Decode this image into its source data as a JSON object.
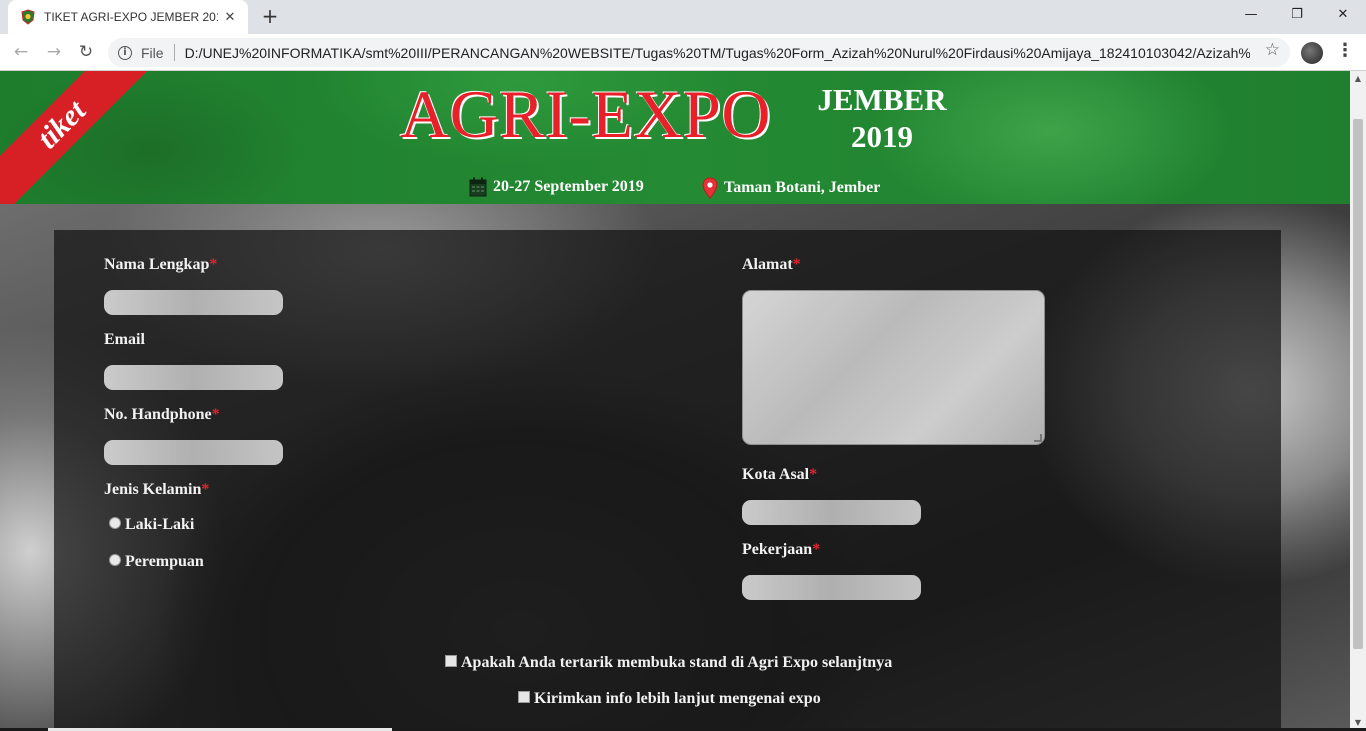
{
  "browser": {
    "tab_title": "TIKET AGRI-EXPO JEMBER 2019",
    "tab_close": "✕",
    "new_tab": "+",
    "window_controls": {
      "minimize": "—",
      "restore": "❐",
      "close": "✕"
    },
    "nav": {
      "back": "←",
      "forward": "→",
      "reload": "↻"
    },
    "file_label": "File",
    "url": "D:/UNEJ%20INFORMATIKA/smt%20III/PERANCANGAN%20WEBSITE/Tugas%20TM/Tugas%20Form_Azizah%20Nurul%20Firdausi%20Amijaya_182410103042/Azizah%20for...",
    "star": "☆",
    "menu": "⋮"
  },
  "header": {
    "ribbon": "tiket",
    "brand": "AGRI-EXPO",
    "brand_city": "JEMBER",
    "brand_year": "2019",
    "date": "20-27 September 2019",
    "location": "Taman Botani, Jember",
    "brand_color": "#e8202a",
    "header_color": "#1f7f2f"
  },
  "form": {
    "nama_label": "Nama Lengkap",
    "email_label": "Email",
    "hp_label": "No. Handphone",
    "gender_label": "Jenis Kelamin",
    "gender_options": [
      "Laki-Laki",
      "Perempuan"
    ],
    "alamat_label": "Alamat",
    "kota_label": "Kota Asal",
    "pekerjaan_label": "Pekerjaan",
    "required_mark": "*",
    "check_stand": "Apakah Anda tertarik membuka stand di Agri Expo selanjtnya",
    "check_info": "Kirimkan info lebih lanjut mengenai expo"
  }
}
